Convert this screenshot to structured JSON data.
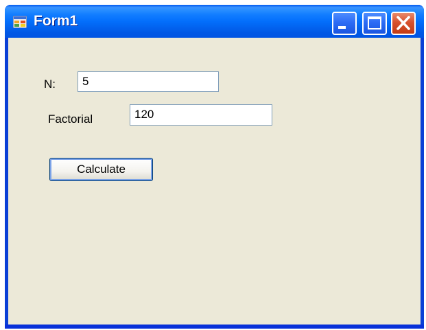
{
  "window": {
    "title": "Form1",
    "icons": {
      "app": "form-app-icon",
      "minimize": "minimize-icon",
      "maximize": "maximize-icon",
      "close": "close-icon"
    }
  },
  "form": {
    "n_label": "N:",
    "n_value": "5",
    "factorial_label": "Factorial",
    "factorial_value": "120",
    "calculate_label": "Calculate"
  },
  "colors": {
    "titlebar": "#0054e3",
    "client": "#ece9d8",
    "close_button": "#c33b14",
    "textbox_border": "#7f9db9"
  }
}
